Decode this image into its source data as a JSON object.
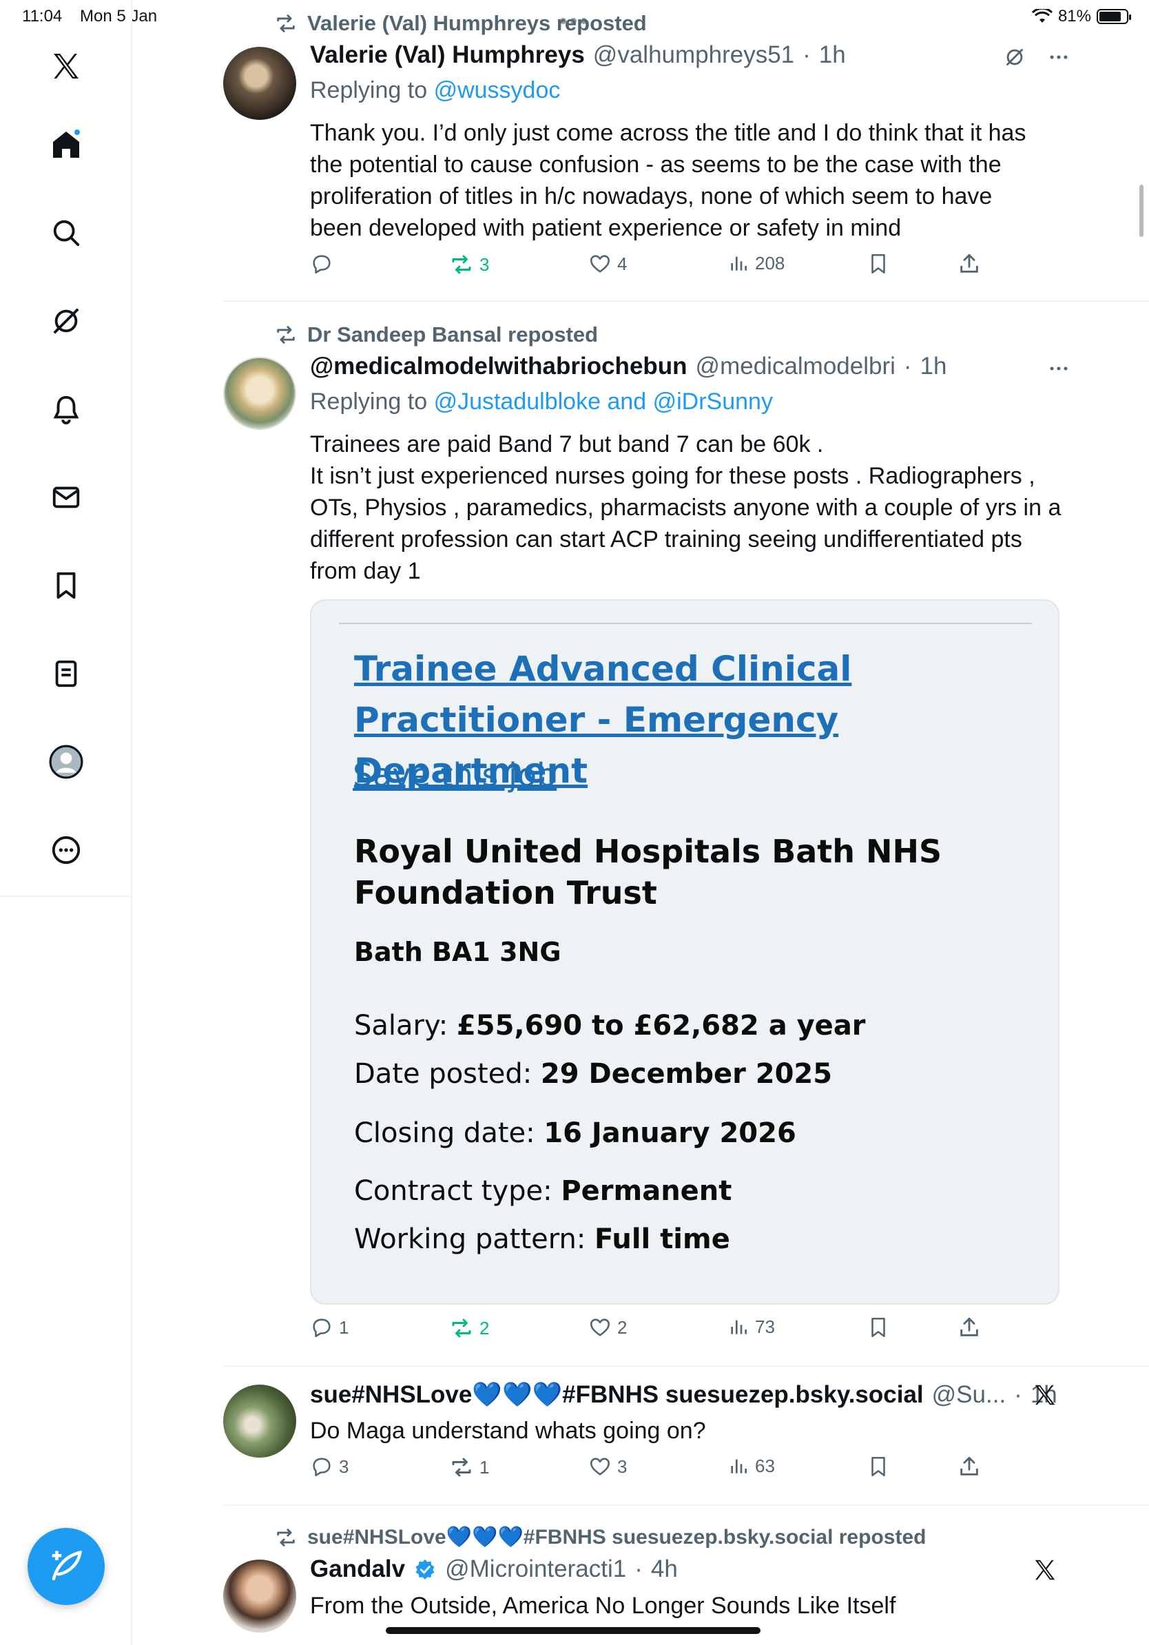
{
  "status": {
    "time": "11:04",
    "date": "Mon 5 Jan",
    "battery": "81%",
    "battery_level": 0.81
  },
  "sidebar": {
    "items": [
      {
        "icon": "x-logo-icon"
      },
      {
        "icon": "home-icon"
      },
      {
        "icon": "search-icon"
      },
      {
        "icon": "grok-icon"
      },
      {
        "icon": "notifications-icon"
      },
      {
        "icon": "messages-icon"
      },
      {
        "icon": "bookmarks-icon"
      },
      {
        "icon": "lists-icon"
      },
      {
        "icon": "profile-icon"
      },
      {
        "icon": "more-icon"
      }
    ],
    "compose_icon": "compose-icon"
  },
  "tweets": [
    {
      "repost_by": "Valerie (Val) Humphreys reposted",
      "name": "Valerie (Val) Humphreys",
      "handle": "@valhumphreys51",
      "time": "1h",
      "reply_prefix": "Replying to",
      "reply_to": "@wussydoc",
      "text": "Thank you. I’d only just come across the title and I do think that it has the potential to cause confusion - as seems to be the case with the proliferation of titles in h/c nowadays, none of which seem to have been developed with patient experience or safety in mind",
      "replies": "",
      "reposts": "3",
      "likes": "4",
      "views": "208"
    },
    {
      "repost_by": "Dr Sandeep Bansal reposted",
      "name": "@medicalmodelwithabriochebun",
      "handle": "@medicalmodelbri",
      "time": "1h",
      "reply_prefix": "Replying to",
      "reply_to": "@Justadulbloke and @iDrSunny",
      "text": "Trainees are paid Band 7 but band 7 can be 60k .\nIt isn’t just experienced nurses going for these posts . Radiographers , OTs, Physios , paramedics, pharmacists anyone with a couple of yrs  in a different profession can start ACP training seeing undifferentiated pts from day 1",
      "replies": "1",
      "reposts": "2",
      "likes": "2",
      "views": "73",
      "card": {
        "title": "Trainee Advanced Clinical Practitioner - Emergency Department",
        "save": "Save this job",
        "employer": "Royal United Hospitals Bath NHS Foundation Trust",
        "location": "Bath BA1 3NG",
        "salary_label": "Salary:",
        "salary": "£55,690 to £62,682 a year",
        "posted_label": "Date posted:",
        "posted": "29 December 2025",
        "closing_label": "Closing date:",
        "closing": "16 January 2026",
        "contract_label": "Contract type:",
        "contract": "Permanent",
        "pattern_label": "Working pattern:",
        "pattern": "Full time"
      }
    },
    {
      "name": "sue#NHSLove💙💙💙#FBNHS suesuezep.bsky.social",
      "handle": "@Su...",
      "time": "1h",
      "text": "Do Maga understand whats going on?",
      "replies": "3",
      "reposts": "1",
      "likes": "3",
      "views": "63"
    },
    {
      "repost_by": "sue#NHSLove💙💙💙#FBNHS suesuezep.bsky.social reposted",
      "name": "Gandalv",
      "handle": "@Microinteracti1",
      "time": "4h",
      "text": "From the Outside, America No Longer Sounds Like Itself"
    }
  ],
  "colors": {
    "accent": "#1d9bf0",
    "repost_green": "#00ba7c",
    "muted": "#536471",
    "nhs_link": "#1d70b8"
  }
}
